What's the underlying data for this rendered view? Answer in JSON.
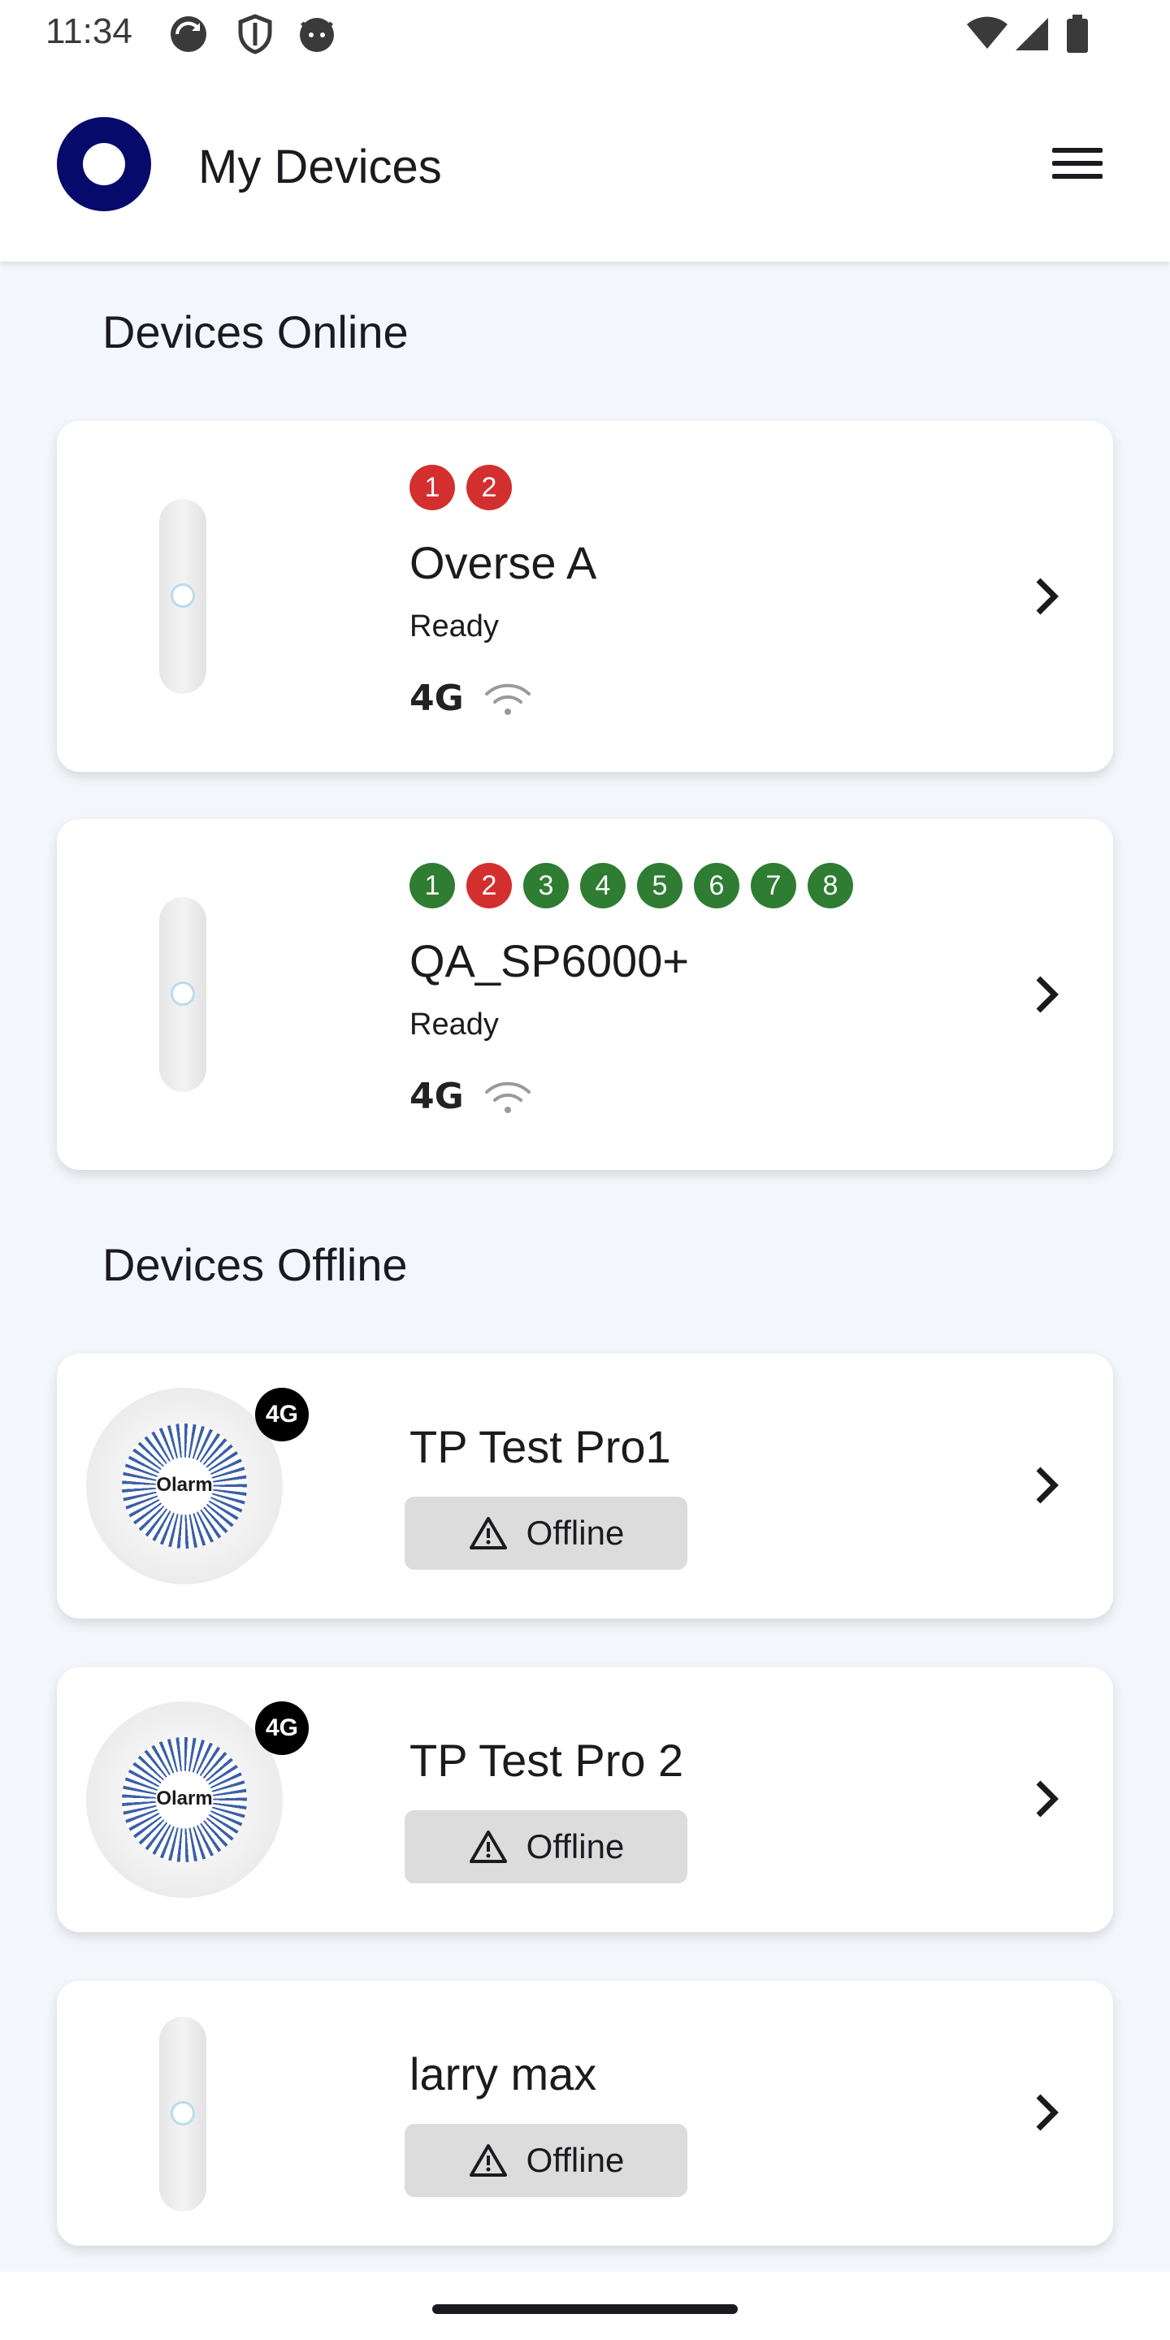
{
  "status_bar": {
    "time": "11:34",
    "left_icons": [
      "sync-icon",
      "shield-icon",
      "cat-face-icon"
    ],
    "right_icons": [
      "wifi-icon",
      "signal-icon",
      "battery-icon"
    ]
  },
  "app_bar": {
    "title": "My Devices",
    "logo_color": "#060a6b",
    "menu_icon": "hamburger-menu-icon"
  },
  "sections": {
    "online": "Devices Online",
    "offline": "Devices Offline"
  },
  "colors": {
    "zone_red": "#d32f2f",
    "zone_green": "#2e7d32"
  },
  "devices_online": [
    {
      "name": "Overse A",
      "status": "Ready",
      "network": "4G",
      "zones": [
        {
          "label": "1",
          "color": "red"
        },
        {
          "label": "2",
          "color": "red"
        }
      ]
    },
    {
      "name": "QA_SP6000+",
      "status": "Ready",
      "network": "4G",
      "zones": [
        {
          "label": "1",
          "color": "green"
        },
        {
          "label": "2",
          "color": "red"
        },
        {
          "label": "3",
          "color": "green"
        },
        {
          "label": "4",
          "color": "green"
        },
        {
          "label": "5",
          "color": "green"
        },
        {
          "label": "6",
          "color": "green"
        },
        {
          "label": "7",
          "color": "green"
        },
        {
          "label": "8",
          "color": "green"
        }
      ]
    }
  ],
  "devices_offline": [
    {
      "name": "TP Test Pro1",
      "status": "Offline",
      "network_badge": "4G",
      "brand": "Olarm"
    },
    {
      "name": "TP Test Pro 2",
      "status": "Offline",
      "network_badge": "4G",
      "brand": "Olarm"
    },
    {
      "name": "larry max",
      "status": "Offline"
    }
  ]
}
